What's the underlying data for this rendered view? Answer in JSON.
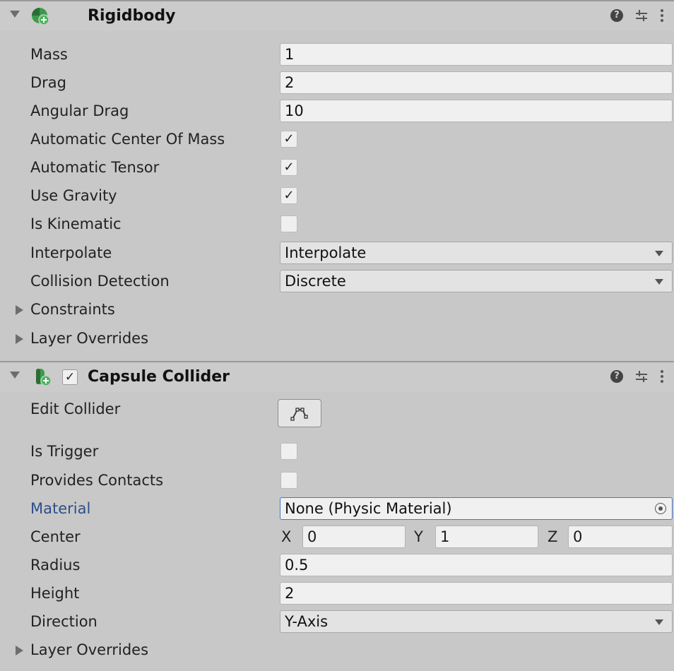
{
  "rigidbody": {
    "title": "Rigidbody",
    "icon": "rigidbody-icon",
    "fields": {
      "mass": {
        "label": "Mass",
        "value": "1"
      },
      "drag": {
        "label": "Drag",
        "value": "2"
      },
      "angular_drag": {
        "label": "Angular Drag",
        "value": "10"
      },
      "auto_center": {
        "label": "Automatic Center Of Mass",
        "checked": true
      },
      "auto_tensor": {
        "label": "Automatic Tensor",
        "checked": true
      },
      "use_gravity": {
        "label": "Use Gravity",
        "checked": true
      },
      "is_kinematic": {
        "label": "Is Kinematic",
        "checked": false
      },
      "interpolate": {
        "label": "Interpolate",
        "value": "Interpolate"
      },
      "collision_detection": {
        "label": "Collision Detection",
        "value": "Discrete"
      }
    },
    "foldouts": {
      "constraints": "Constraints",
      "layer_overrides": "Layer Overrides"
    }
  },
  "capsule": {
    "title": "Capsule Collider",
    "icon": "capsule-collider-icon",
    "enabled": true,
    "fields": {
      "edit_collider": {
        "label": "Edit Collider"
      },
      "is_trigger": {
        "label": "Is Trigger",
        "checked": false
      },
      "provides_contacts": {
        "label": "Provides Contacts",
        "checked": false
      },
      "material": {
        "label": "Material",
        "value": "None (Physic Material)"
      },
      "center": {
        "label": "Center",
        "x_label": "X",
        "x": "0",
        "y_label": "Y",
        "y": "1",
        "z_label": "Z",
        "z": "0"
      },
      "radius": {
        "label": "Radius",
        "value": "0.5"
      },
      "height": {
        "label": "Height",
        "value": "2"
      },
      "direction": {
        "label": "Direction",
        "value": "Y-Axis"
      }
    },
    "foldouts": {
      "layer_overrides": "Layer Overrides"
    }
  },
  "header_icons": {
    "help": "?",
    "help_icon": "help-icon",
    "presets_icon": "presets-icon",
    "menu_icon": "kebab-menu-icon"
  },
  "colors": {
    "background": "#c8c8c8",
    "field": "#f0f0f0",
    "link_label": "#2c4f8a",
    "focus_border": "#4a76c4",
    "rigidbody_icon_green": "#3a9b4a"
  }
}
